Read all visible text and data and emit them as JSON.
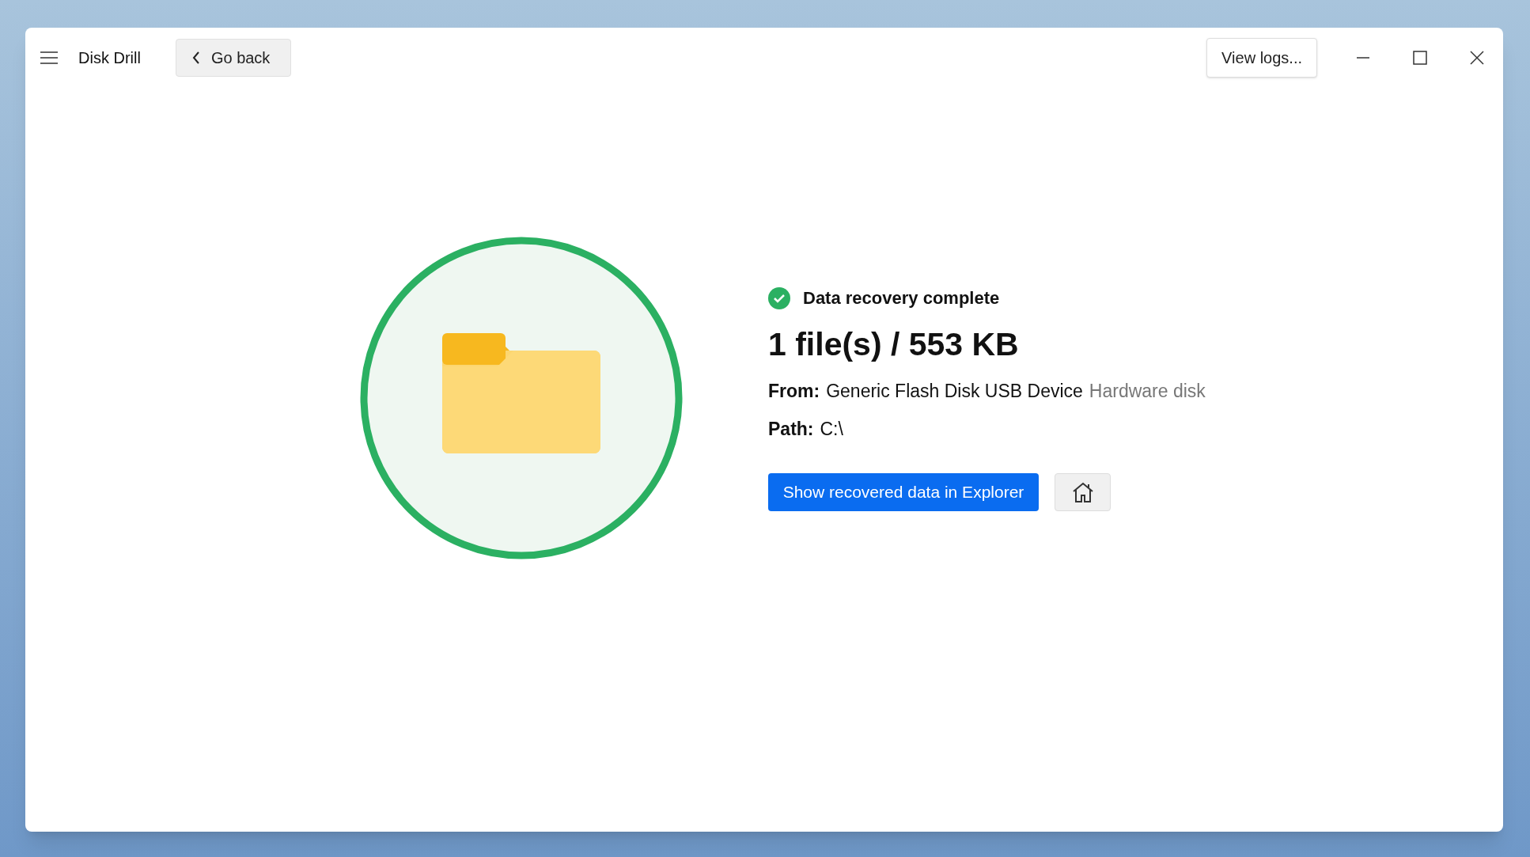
{
  "window": {
    "title": "Disk Drill",
    "back_button": "Go back",
    "logs_button": "View logs..."
  },
  "result": {
    "status": "Data recovery complete",
    "complete": true,
    "summary": "1 file(s) / 553 KB",
    "from_label": "From:",
    "from_value": "Generic Flash Disk USB Device",
    "from_type": "Hardware disk",
    "path_label": "Path:",
    "path_value": "C:\\"
  },
  "actions": {
    "primary": "Show recovered data in Explorer"
  }
}
